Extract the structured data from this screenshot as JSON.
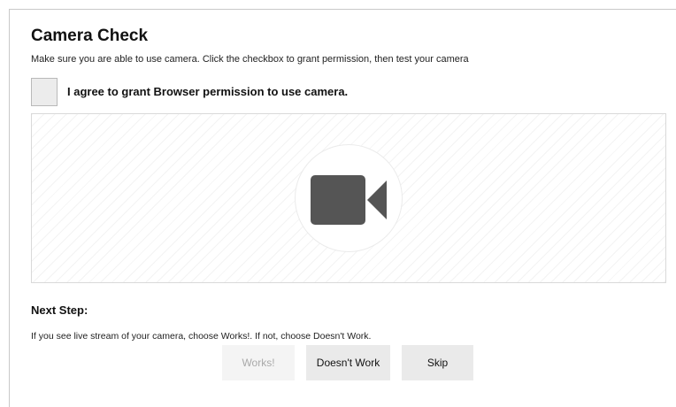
{
  "page": {
    "title": "Camera Check",
    "subtitle": "Make sure you are able to use camera. Click the checkbox to grant permission, then test your camera"
  },
  "consent": {
    "label": "I agree to grant Browser permission to use camera.",
    "checked": false
  },
  "preview": {
    "icon": "video-camera-icon",
    "icon_color": "#555555"
  },
  "next_step": {
    "heading": "Next Step:",
    "instructions": "If you see live stream of your camera, choose Works!. If not, choose Doesn't Work."
  },
  "buttons": {
    "works": "Works!",
    "works_disabled": true,
    "doesnt_work": "Doesn't Work",
    "skip": "Skip"
  }
}
